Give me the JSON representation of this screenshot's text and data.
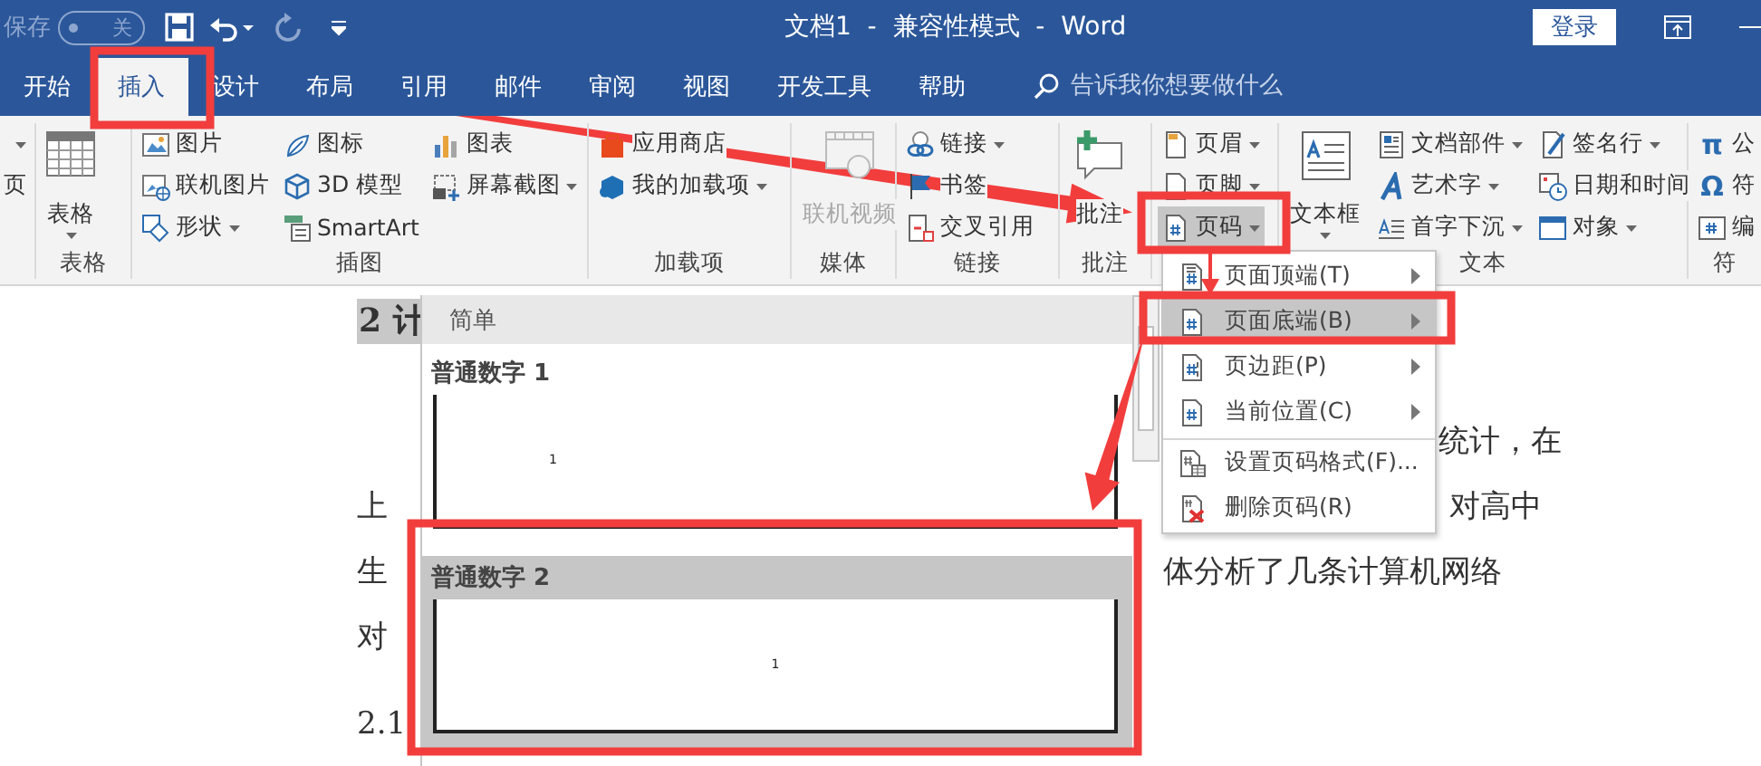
{
  "title_bar": {
    "autosave_label": "保存",
    "autosave_state": "关",
    "title": "文档1  -  兼容性模式  -  Word",
    "sign_in": "登录"
  },
  "tabs": [
    {
      "label": "开始",
      "selected": false
    },
    {
      "label": "插入",
      "selected": true
    },
    {
      "label": "设计",
      "selected": false
    },
    {
      "label": "布局",
      "selected": false
    },
    {
      "label": "引用",
      "selected": false
    },
    {
      "label": "邮件",
      "selected": false
    },
    {
      "label": "审阅",
      "selected": false
    },
    {
      "label": "视图",
      "selected": false
    },
    {
      "label": "开发工具",
      "selected": false
    },
    {
      "label": "帮助",
      "selected": false
    }
  ],
  "tell_me": {
    "placeholder": "告诉我你想要做什么"
  },
  "ribbon": {
    "groups": [
      {
        "items": [
          {
            "kind": "caret",
            "dropdown": true,
            "pressed": false,
            "disabled": false
          },
          {
            "kind": "small",
            "label": "页",
            "dropdown": false,
            "pressed": false,
            "disabled": false
          }
        ]
      },
      {
        "label": "表格",
        "items": [
          {
            "kind": "large",
            "label": "表格",
            "dropdown": true,
            "pressed": false,
            "disabled": false
          }
        ]
      },
      {
        "label": "插图",
        "items": [
          {
            "kind": "small",
            "label": "图片",
            "dropdown": false,
            "pressed": false,
            "disabled": false
          },
          {
            "kind": "small",
            "label": "联机图片",
            "dropdown": false,
            "pressed": false,
            "disabled": false
          },
          {
            "kind": "small",
            "label": "形状",
            "dropdown": true,
            "pressed": false,
            "disabled": false
          },
          {
            "kind": "small",
            "label": "图标",
            "dropdown": false,
            "pressed": false,
            "disabled": false
          },
          {
            "kind": "small",
            "label": "3D 模型",
            "dropdown": false,
            "pressed": false,
            "disabled": false
          },
          {
            "kind": "small",
            "label": "SmartArt",
            "dropdown": false,
            "pressed": false,
            "disabled": false
          },
          {
            "kind": "small",
            "label": "图表",
            "dropdown": false,
            "pressed": false,
            "disabled": false
          },
          {
            "kind": "small",
            "label": "屏幕截图",
            "dropdown": true,
            "pressed": false,
            "disabled": false
          }
        ]
      },
      {
        "label": "加载项",
        "items": [
          {
            "kind": "small",
            "label": "应用商店",
            "dropdown": false,
            "pressed": false,
            "disabled": false
          },
          {
            "kind": "small",
            "label": "我的加载项",
            "dropdown": true,
            "pressed": false,
            "disabled": false
          }
        ]
      },
      {
        "label": "媒体",
        "items": [
          {
            "kind": "large",
            "label": "联机视频",
            "dropdown": false,
            "pressed": false,
            "disabled": true
          }
        ]
      },
      {
        "label": "链接",
        "items": [
          {
            "kind": "small",
            "label": "链接",
            "dropdown": true,
            "pressed": false,
            "disabled": false
          },
          {
            "kind": "small",
            "label": "书签",
            "dropdown": false,
            "pressed": false,
            "disabled": false
          },
          {
            "kind": "small",
            "label": "交叉引用",
            "dropdown": false,
            "pressed": false,
            "disabled": false
          }
        ]
      },
      {
        "label": "批注",
        "items": [
          {
            "kind": "large",
            "label": "批注",
            "dropdown": false,
            "pressed": false,
            "disabled": false
          }
        ]
      },
      {
        "items": [
          {
            "kind": "small",
            "label": "页眉",
            "dropdown": true,
            "pressed": false,
            "disabled": false
          },
          {
            "kind": "small",
            "label": "页脚",
            "dropdown": true,
            "pressed": false,
            "disabled": false
          },
          {
            "kind": "small",
            "label": "页码",
            "dropdown": true,
            "pressed": true,
            "disabled": false
          }
        ]
      },
      {
        "label": "文本",
        "items": [
          {
            "kind": "large",
            "label": "文本框",
            "dropdown": true,
            "pressed": false,
            "disabled": false
          },
          {
            "kind": "small",
            "label": "文档部件",
            "dropdown": true,
            "pressed": false,
            "disabled": false
          },
          {
            "kind": "small",
            "label": "艺术字",
            "dropdown": true,
            "pressed": false,
            "disabled": false
          },
          {
            "kind": "small",
            "label": "首字下沉",
            "dropdown": true,
            "pressed": false,
            "disabled": false
          },
          {
            "kind": "small",
            "label": "签名行",
            "dropdown": true,
            "pressed": false,
            "disabled": false
          },
          {
            "kind": "small",
            "label": "日期和时间",
            "dropdown": false,
            "pressed": false,
            "disabled": false
          },
          {
            "kind": "small",
            "label": "对象",
            "dropdown": true,
            "pressed": false,
            "disabled": false
          }
        ]
      },
      {
        "label": "符",
        "items": [
          {
            "kind": "small",
            "icon_char": "π",
            "label": "公"
          },
          {
            "kind": "small",
            "icon_char": "Ω",
            "label": "符"
          },
          {
            "kind": "small",
            "label": "编"
          }
        ]
      }
    ]
  },
  "document": {
    "heading": "2 计",
    "lines": [
      {
        "right": "统计，在"
      },
      {
        "left": "上",
        "right": "对高中"
      },
      {
        "left": "生",
        "right": "体分析了几条计算机网络"
      },
      {
        "left": "对"
      }
    ],
    "subheading": "2.1"
  },
  "page_number_gallery": {
    "header": "简单",
    "items": [
      {
        "label": "普通数字 1",
        "preview": "1",
        "selected": false
      },
      {
        "label": "普通数字 2",
        "preview": "1",
        "selected": true
      }
    ]
  },
  "page_number_menu": {
    "items": [
      {
        "label": "页面顶端(T)",
        "submenu": true,
        "separator_before": false,
        "selected": false
      },
      {
        "label": "页面底端(B)",
        "submenu": true,
        "separator_before": false,
        "selected": true
      },
      {
        "label": "页边距(P)",
        "submenu": true,
        "separator_before": false,
        "selected": false
      },
      {
        "label": "当前位置(C)",
        "submenu": true,
        "separator_before": false,
        "selected": false
      },
      {
        "label": "设置页码格式(F)...",
        "submenu": false,
        "separator_before": true,
        "selected": false
      },
      {
        "label": "删除页码(R)",
        "submenu": false,
        "separator_before": false,
        "selected": false
      }
    ]
  },
  "annotations": [
    {
      "kind": "frame"
    },
    {
      "kind": "frame"
    },
    {
      "kind": "frame"
    },
    {
      "kind": "frame"
    },
    {
      "kind": "arrow"
    },
    {
      "kind": "arrow"
    },
    {
      "kind": "arrow"
    }
  ]
}
